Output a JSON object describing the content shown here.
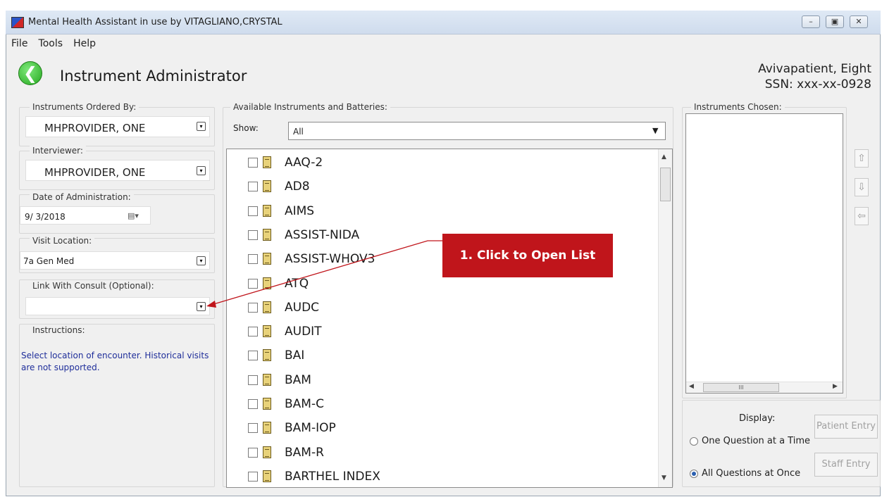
{
  "window": {
    "title": "Mental Health Assistant in use by VITAGLIANO,CRYSTAL",
    "minimize": "–",
    "maximize": "▣",
    "close": "✕"
  },
  "menu": [
    "File",
    "Tools",
    "Help"
  ],
  "header": {
    "title": "Instrument Administrator",
    "back_icon": "back-arrow-icon",
    "patient_name": "Avivapatient, Eight",
    "patient_ssn": "SSN: xxx-xx-0928"
  },
  "left": {
    "ordered_by_label": "Instruments Ordered By:",
    "ordered_by_value": "MHPROVIDER, ONE",
    "interviewer_label": "Interviewer:",
    "interviewer_value": "MHPROVIDER, ONE",
    "date_label": "Date of Administration:",
    "date_value": "9/ 3/2018",
    "visit_label": "Visit Location:",
    "visit_value": "7a Gen Med",
    "consult_label": "Link With Consult (Optional):",
    "consult_value": "",
    "instructions_label": "Instructions:",
    "instructions_text": "Select location of encounter. Historical visits are not supported."
  },
  "center": {
    "group_label": "Available Instruments and Batteries:",
    "show_label": "Show:",
    "show_value": "All",
    "items": [
      "AAQ-2",
      "AD8",
      "AIMS",
      "ASSIST-NIDA",
      "ASSIST-WHOV3",
      "ATQ",
      "AUDC",
      "AUDIT",
      "BAI",
      "BAM",
      "BAM-C",
      "BAM-IOP",
      "BAM-R",
      "BARTHEL INDEX"
    ]
  },
  "right": {
    "chosen_label": "Instruments Chosen:",
    "scroll_grip": "III",
    "move_up": "⇧",
    "move_down": "⇩",
    "remove": "⇦",
    "display_label": "Display:",
    "option_one": "One Question at a Time",
    "option_all": "All Questions at Once",
    "selected_option": "All Questions at Once",
    "patient_entry": "Patient Entry",
    "staff_entry": "Staff Entry"
  },
  "callout": {
    "text": "1. Click to Open List",
    "color": "#c0151b"
  }
}
